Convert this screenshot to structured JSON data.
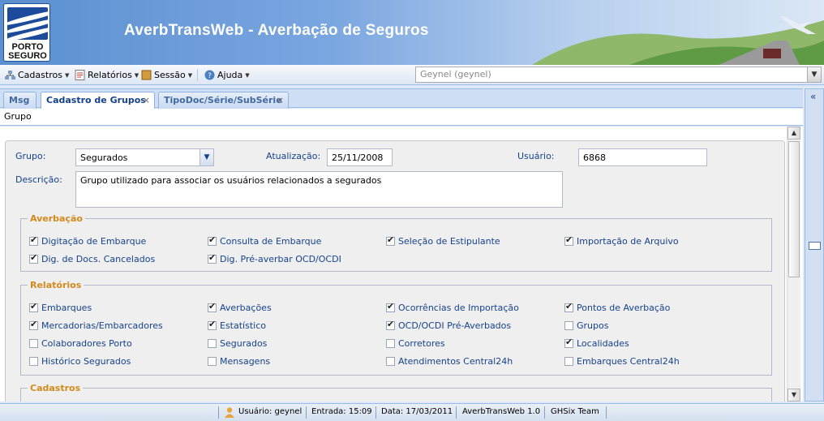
{
  "header": {
    "title": "AverbTransWeb - Averbação de Seguros",
    "logo_top": "PORTO",
    "logo_bottom": "SEGURO"
  },
  "menu": {
    "items": [
      {
        "label": "Cadastros",
        "icon": "network-icon"
      },
      {
        "label": "Relatórios",
        "icon": "report-icon"
      },
      {
        "label": "Sessão",
        "icon": "session-icon"
      },
      {
        "label": "Ajuda",
        "icon": "help-icon"
      }
    ],
    "user_value": "Geynel   (geynel)"
  },
  "tabs": [
    {
      "label": "Msg",
      "closable": false,
      "active": false
    },
    {
      "label": "Cadastro de Grupos",
      "closable": true,
      "active": true
    },
    {
      "label": "TipoDoc/Série/SubSérie",
      "closable": true,
      "active": false
    }
  ],
  "subheader": "Grupo",
  "form": {
    "grupo_label": "Grupo:",
    "grupo_value": "Segurados",
    "atualizacao_label": "Atualização:",
    "atualizacao_value": "25/11/2008",
    "usuario_label": "Usuário:",
    "usuario_value": "6868",
    "descricao_label": "Descrição:",
    "descricao_value": "Grupo utilizado para associar os usuários relacionados a segurados"
  },
  "averbacao": {
    "legend": "Averbação",
    "items": [
      {
        "label": "Digitação de Embarque",
        "checked": true
      },
      {
        "label": "Consulta de Embarque",
        "checked": true
      },
      {
        "label": "Seleção de Estipulante",
        "checked": true
      },
      {
        "label": "Importação de Arquivo",
        "checked": true
      },
      {
        "label": "Dig. de Docs. Cancelados",
        "checked": true
      },
      {
        "label": "Dig. Pré-averbar OCD/OCDI",
        "checked": true
      }
    ]
  },
  "relatorios": {
    "legend": "Relatórios",
    "items": [
      {
        "label": "Embarques",
        "checked": true
      },
      {
        "label": "Averbações",
        "checked": true
      },
      {
        "label": "Ocorrências de Importação",
        "checked": true
      },
      {
        "label": "Pontos de Averbação",
        "checked": true
      },
      {
        "label": "Mercadorias/Embarcadores",
        "checked": true
      },
      {
        "label": "Estatístico",
        "checked": true
      },
      {
        "label": "OCD/OCDI Pré-Averbados",
        "checked": true
      },
      {
        "label": "Grupos",
        "checked": false
      },
      {
        "label": "Colaboradores Porto",
        "checked": false
      },
      {
        "label": "Segurados",
        "checked": false
      },
      {
        "label": "Corretores",
        "checked": false
      },
      {
        "label": "Localidades",
        "checked": true
      },
      {
        "label": "Histórico Segurados",
        "checked": false
      },
      {
        "label": "Mensagens",
        "checked": false
      },
      {
        "label": "Atendimentos Central24h",
        "checked": false
      },
      {
        "label": "Embarques Central24h",
        "checked": false
      }
    ]
  },
  "cadastros": {
    "legend": "Cadastros"
  },
  "status": {
    "usuario": "Usuário: geynel",
    "entrada": "Entrada: 15:09",
    "data": "Data: 17/03/2011",
    "app": "AverbTransWeb 1.0",
    "team": "GHSix Team"
  },
  "colors": {
    "header_blue": "#5b8fd0",
    "label_blue": "#15428b",
    "legend_orange": "#d38a1b"
  }
}
